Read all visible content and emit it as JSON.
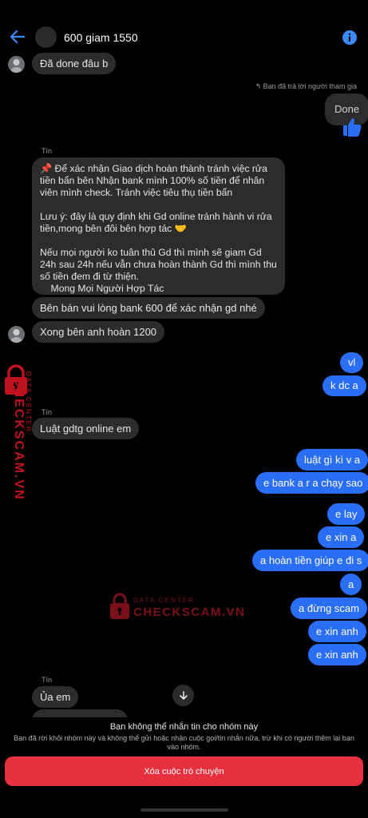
{
  "header": {
    "title": "600 giam 1550"
  },
  "messages": {
    "m1": "Đã done đâu b",
    "reply_note": "Bạn đã trả lời người tham gia",
    "m2": "Done",
    "sender_1": "Tín",
    "long_p1": "📌 Để xác nhận Giao dịch hoàn thành tránh việc rửa tiền bẩn  bên Nhận bank mình 100% số tiền để nhân viên mình check. Tránh việc tiêu thụ tiền bẩn",
    "long_p2": "Lưu ý: đây là quy định khi Gd online tránh hành vi rửa tiền,mong bên đôi bên hợp tác 🤝",
    "long_p3": "Nếu mọi người ko tuân thủ Gd thì mình sẽ giam Gd 24h sau 24h nếu vẫn chưa hoàn thành Gd thì mình thu số tiền đem đi từ thiện.",
    "long_p4": "    Mong Mọi Người Hợp Tác",
    "m3": "Bên bán vui lòng bank 600 để xác nhận gd nhé",
    "m4": "Xong bên anh hoàn 1200",
    "m5": "vl",
    "m6": "k dc a",
    "sender_2": "Tín",
    "m7": "Luật gdtg online em",
    "m8": "luật gì kì v a",
    "m9": "e bank a r a chạy sao",
    "m10": "e lay",
    "m11": "e xin a",
    "m12": "a hoàn tiền giúp e đi s",
    "m13": "a",
    "m14": "a đừng scam",
    "m15": "e xin anh",
    "m16": "e xin anh",
    "sender_3": "Tín",
    "m17": "Ủa em"
  },
  "watermark": {
    "side_top": "DATA CENTER",
    "side_main": "CHECKSCAM.VN",
    "center_top": "DATA CENTER",
    "center_main": "CHECKSCAM.VN"
  },
  "footer": {
    "notice_title": "Bạn không thể nhắn tin cho nhóm này",
    "notice_body": "Bạn đã rời khỏi nhóm này và không thể gửi hoặc nhận cuộc gọi/tin nhắn nữa, trừ khi có người thêm lại bạn vào nhóm.",
    "delete_label": "Xóa cuộc trò chuyện"
  },
  "colors": {
    "accent": "#2a6ef5",
    "danger": "#e8303f",
    "watermark": "#c0121f"
  }
}
